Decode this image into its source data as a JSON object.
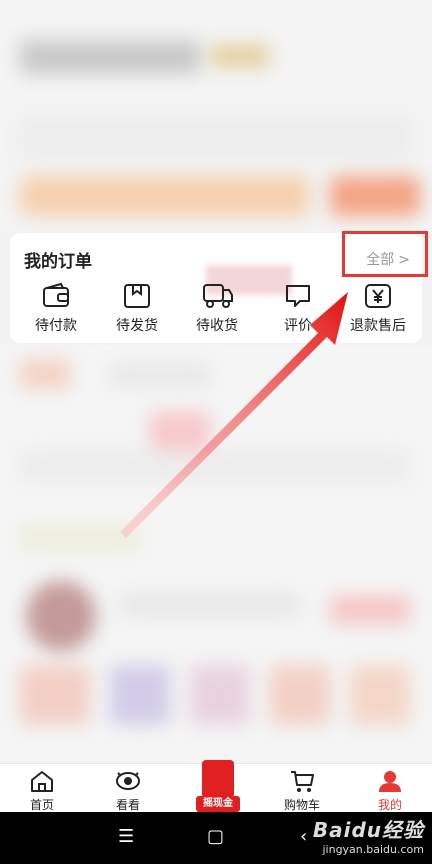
{
  "orders": {
    "title": "我的订单",
    "view_all": "全部",
    "items": [
      {
        "label": "待付款",
        "icon": "wallet-icon"
      },
      {
        "label": "待发货",
        "icon": "package-icon"
      },
      {
        "label": "待收货",
        "icon": "truck-icon"
      },
      {
        "label": "评价",
        "icon": "comment-icon"
      },
      {
        "label": "退款售后",
        "icon": "refund-icon"
      }
    ]
  },
  "tabbar": {
    "items": [
      {
        "label": "首页",
        "icon": "home-icon"
      },
      {
        "label": "看看",
        "icon": "eye-icon"
      },
      {
        "label": "摇现金",
        "icon": "red-packet-icon"
      },
      {
        "label": "购物车",
        "icon": "cart-icon"
      },
      {
        "label": "我的",
        "icon": "profile-icon",
        "active": true
      }
    ]
  },
  "watermark": {
    "brand": "Baidu经验",
    "url": "jingyan.baidu.com"
  },
  "colors": {
    "accent": "#e53935",
    "annotation": "#e53935"
  }
}
